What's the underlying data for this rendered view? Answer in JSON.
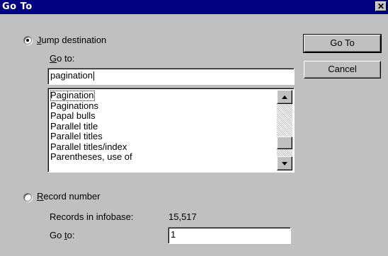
{
  "window": {
    "title": "Go To",
    "close_glyph": "✕"
  },
  "jump": {
    "label": "Jump destination",
    "mnemonic": "J",
    "label_rest": "ump destination",
    "goto_label_mnemonic": "G",
    "goto_label_rest": "o to:",
    "goto_value": "pagination",
    "list_items": [
      "Pagination",
      "Paginations",
      "Papal bulls",
      "Parallel title",
      "Parallel titles",
      "Parallel titles/index",
      "Parentheses, use of"
    ]
  },
  "record": {
    "mnemonic": "R",
    "label_rest": "ecord number",
    "records_label": "Records in infobase:",
    "records_count": "15,517",
    "goto_label_pre": "Go ",
    "goto_label_mnemonic": "t",
    "goto_label_rest": "o:",
    "goto_value": "1"
  },
  "buttons": {
    "goto": "Go To",
    "cancel": "Cancel"
  },
  "icons": {
    "scroll_up": "up-arrow-icon",
    "scroll_down": "down-arrow-icon"
  }
}
